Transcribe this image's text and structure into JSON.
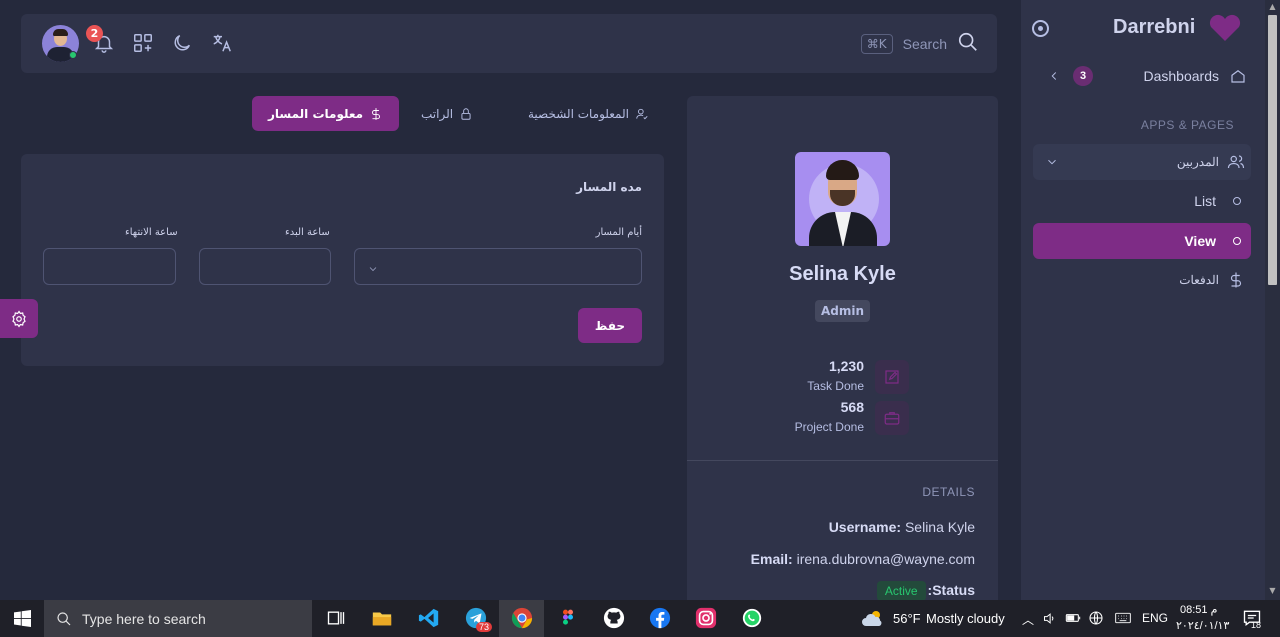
{
  "navbar": {
    "notification_count": "2",
    "search_shortcut": "⌘K",
    "search_label": "Search"
  },
  "tabs": [
    {
      "label": "المعلومات الشخصية",
      "icon": "user-check-icon",
      "active": false
    },
    {
      "label": "الراتب",
      "icon": "lock-icon",
      "active": false
    },
    {
      "label": "معلومات المسار",
      "icon": "dollar-icon",
      "active": true
    }
  ],
  "form": {
    "title": "مده المسار",
    "fields": [
      {
        "label": "أيام المسار",
        "type": "select",
        "value": ""
      },
      {
        "label": "ساعة البدء",
        "type": "input",
        "value": ""
      },
      {
        "label": "ساعة الانتهاء",
        "type": "input",
        "value": ""
      }
    ],
    "save_label": "حفظ"
  },
  "profile": {
    "name": "Selina Kyle",
    "role": "Admin",
    "stats": [
      {
        "value": "1,230",
        "label": "Task Done",
        "icon": "edit-icon"
      },
      {
        "value": "568",
        "label": "Project Done",
        "icon": "briefcase-icon"
      }
    ],
    "details_heading": "DETAILS",
    "details": [
      {
        "key": "Username:",
        "value": "Selina Kyle"
      },
      {
        "key": "Email:",
        "value": "irena.dubrovna@wayne.com"
      }
    ],
    "status_key": ":Status",
    "status_value": "Active"
  },
  "sidebar": {
    "brand": "Darrebni",
    "dashboards_label": "Dashboards",
    "dashboards_count": "3",
    "section_header": "APPS & PAGES",
    "trainers_label": "المدربين",
    "list_label": "List",
    "view_label": "View",
    "payments_label": "الدفعات"
  },
  "taskbar": {
    "search_placeholder": "Type here to search",
    "telegram_badge": "73",
    "weather_temp": "56°F",
    "weather_desc": "Mostly cloudy",
    "language": "ENG",
    "time": "08:51 م",
    "date": "٢٠٢٤/٠١/١٣",
    "notifications_count": "18"
  },
  "colors": {
    "accent": "#7e2c86",
    "background": "#25293c",
    "card": "#2f3349",
    "success": "#28c76f",
    "danger": "#ea5455"
  }
}
